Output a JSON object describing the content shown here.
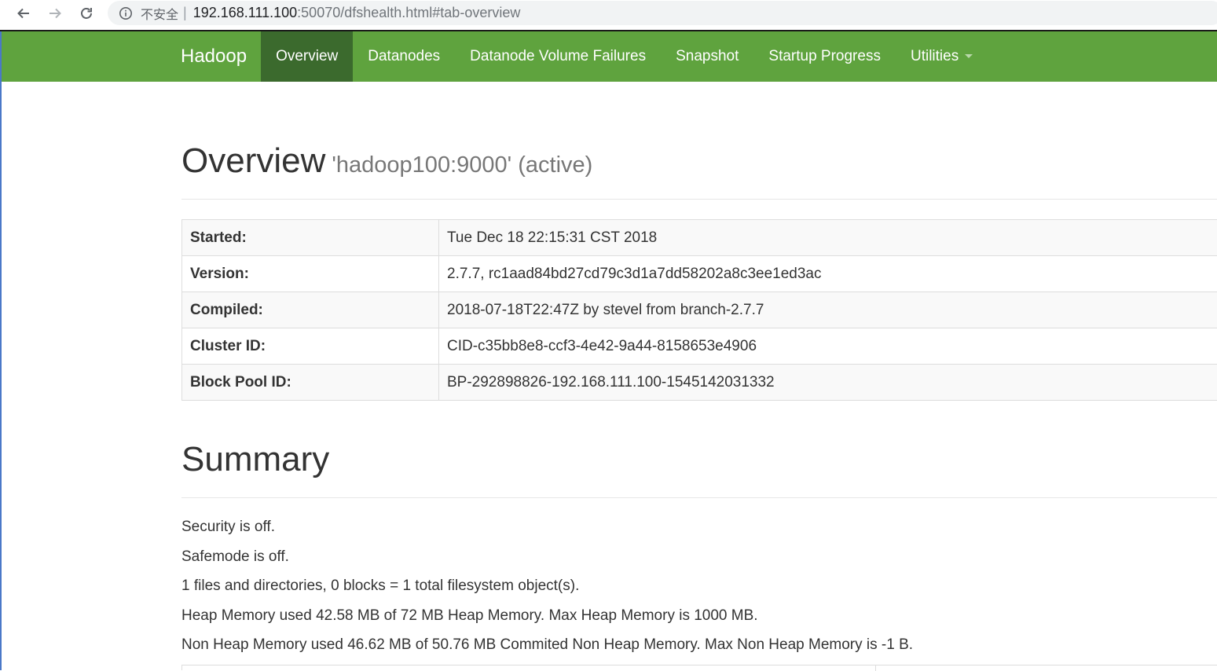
{
  "browser": {
    "security_label": "不安全",
    "separator": "|",
    "url_host": "192.168.111.100",
    "url_rest": ":50070/dfshealth.html#tab-overview"
  },
  "navbar": {
    "brand": "Hadoop",
    "items": [
      {
        "label": "Overview",
        "active": true
      },
      {
        "label": "Datanodes"
      },
      {
        "label": "Datanode Volume Failures"
      },
      {
        "label": "Snapshot"
      },
      {
        "label": "Startup Progress"
      },
      {
        "label": "Utilities",
        "dropdown": true
      }
    ],
    "color": "#5fa33e",
    "active_color": "#3b6a2d"
  },
  "overview": {
    "title": "Overview",
    "subtitle": "'hadoop100:9000' (active)",
    "rows": [
      {
        "label": "Started:",
        "value": "Tue Dec 18 22:15:31 CST 2018"
      },
      {
        "label": "Version:",
        "value": "2.7.7, rc1aad84bd27cd79c3d1a7dd58202a8c3ee1ed3ac"
      },
      {
        "label": "Compiled:",
        "value": "2018-07-18T22:47Z by stevel from branch-2.7.7"
      },
      {
        "label": "Cluster ID:",
        "value": "CID-c35bb8e8-ccf3-4e42-9a44-8158653e4906"
      },
      {
        "label": "Block Pool ID:",
        "value": "BP-292898826-192.168.111.100-1545142031332"
      }
    ]
  },
  "summary": {
    "title": "Summary",
    "lines": [
      "Security is off.",
      "Safemode is off.",
      "1 files and directories, 0 blocks = 1 total filesystem object(s).",
      "Heap Memory used 42.58 MB of 72 MB Heap Memory. Max Heap Memory is 1000 MB.",
      "Non Heap Memory used 46.62 MB of 50.76 MB Commited Non Heap Memory. Max Non Heap Memory is -1 B."
    ]
  }
}
